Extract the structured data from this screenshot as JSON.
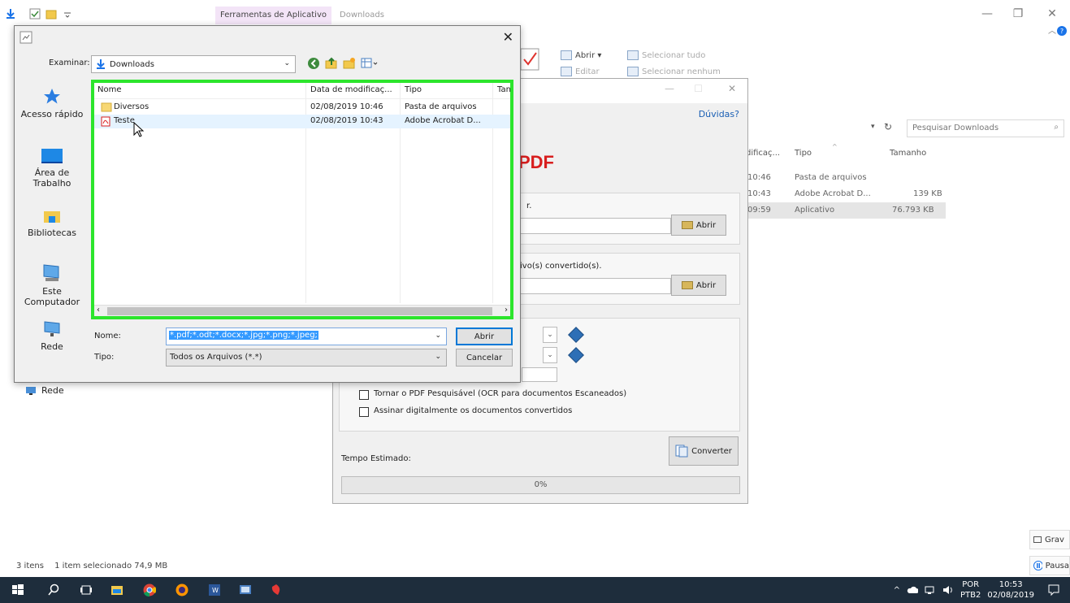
{
  "explorer": {
    "tools_tab": "Ferramentas de Aplicativo",
    "title": "Downloads",
    "ribbon": {
      "open": "Abrir ▾",
      "edit": "Editar",
      "select_all": "Selecionar tudo",
      "select_none": "Selecionar nenhum"
    },
    "search_placeholder": "Pesquisar Downloads",
    "columns": {
      "modified": "dificaç...",
      "type": "Tipo",
      "size": "Tamanho"
    },
    "rows": [
      {
        "time": "10:46",
        "type": "Pasta de arquivos",
        "size": ""
      },
      {
        "time": "10:43",
        "type": "Adobe Acrobat D...",
        "size": "139 KB"
      },
      {
        "time": "09:59",
        "type": "Aplicativo",
        "size": "76.793 KB"
      }
    ],
    "status_items": "3 itens",
    "status_selected": "1 item selecionado  74,9 MB",
    "nav_rede": "Rede"
  },
  "converter": {
    "help": "Dúvidas?",
    "heading": "PDF",
    "input_hint": "r.",
    "output_hint": "ivo(s) convertido(s).",
    "open_btn": "Abrir",
    "ocr_label": "Tornar o PDF Pesquisável (OCR para documentos Escaneados)",
    "sign_label": "Assinar digitalmente os documentos convertidos",
    "convert_btn": "Converter",
    "eta_label": "Tempo Estimado:",
    "progress_text": "0%",
    "progress_value": 0
  },
  "dialog": {
    "look_in_label": "Examinar:",
    "location": "Downloads",
    "places": [
      {
        "label": "Acesso rápido"
      },
      {
        "label": "Área de Trabalho"
      },
      {
        "label": "Bibliotecas"
      },
      {
        "label": "Este Computador"
      },
      {
        "label": "Rede"
      }
    ],
    "columns": {
      "name": "Nome",
      "date": "Data de modificaç...",
      "type": "Tipo",
      "size": "Tan"
    },
    "files": [
      {
        "name": "Diversos",
        "date": "02/08/2019 10:46",
        "type": "Pasta de arquivos"
      },
      {
        "name": "Teste",
        "date": "02/08/2019 10:43",
        "type": "Adobe Acrobat D..."
      }
    ],
    "name_label": "Nome:",
    "name_value": "*.pdf;*.odt;*.docx;*.jpg;*.png;*.jpeg;",
    "type_label": "Tipo:",
    "type_value": "Todos os Arquivos (*.*)",
    "open_btn": "Abrir",
    "cancel_btn": "Cancelar"
  },
  "side_notes": {
    "record": "Grav",
    "pause": "Pausa"
  },
  "taskbar": {
    "lang": "POR",
    "layout": "PTB2",
    "time": "10:53",
    "date": "02/08/2019"
  },
  "colors": {
    "highlight_border": "#2ce52c",
    "taskbar": "#1e2d3c",
    "pdf_red": "#d81e1e",
    "selection_blue": "#3399ff"
  }
}
